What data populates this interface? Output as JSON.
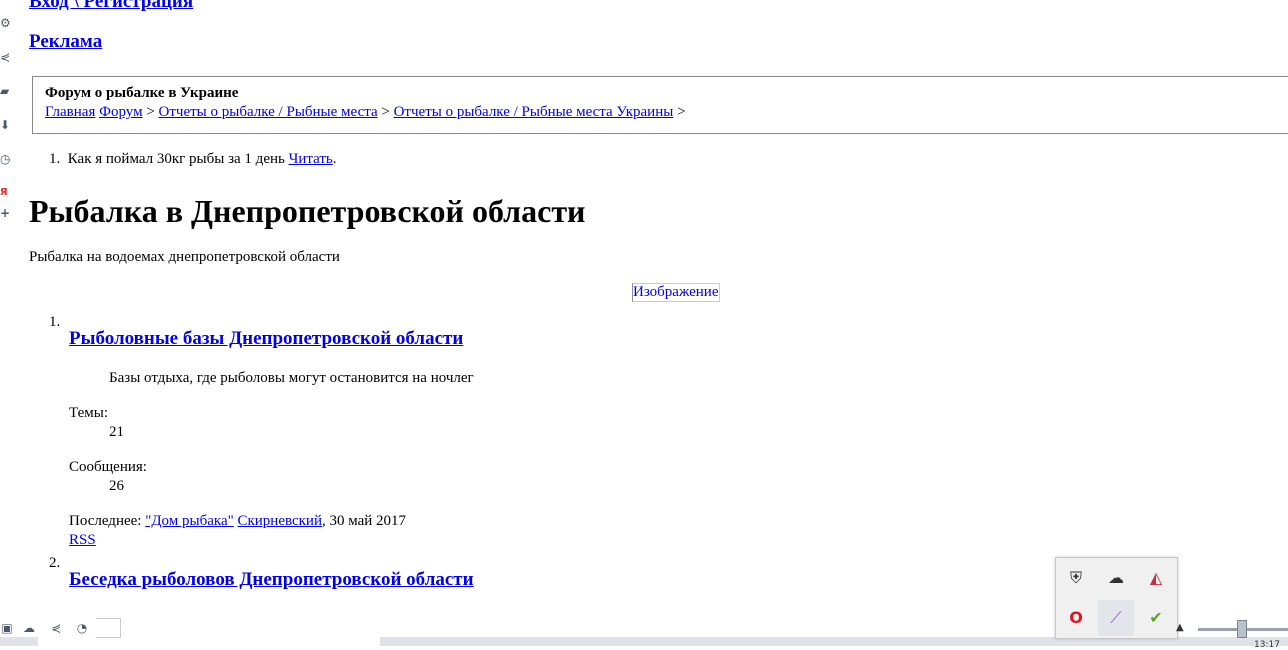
{
  "header": {
    "login_link": "Вход \\ Регистрация",
    "ads_link": "Реклама"
  },
  "breadcrumb": {
    "site_title": "Форум о рыбалке в Украине",
    "items": [
      "Главная",
      "Форум",
      "Отчеты о рыбалке / Рыбные места",
      "Отчеты о рыбалке / Рыбные места Украины"
    ],
    "separator": ">"
  },
  "news": {
    "number": "1.",
    "text": "Как я поймал 30кг рыбы за 1 день",
    "link": "Читать",
    "tail": "."
  },
  "page": {
    "title": "Рыбалка в Днепропетровской области",
    "description": "Рыбалка на водоемах днепропетровской области",
    "image_alt": "Изображение"
  },
  "forums": [
    {
      "number": "1.",
      "title": "Рыболовные базы Днепропетровской области",
      "description": "Базы отдыха, где рыболовы могут остановится на ночлег",
      "topics_label": "Темы:",
      "topics": "21",
      "messages_label": "Сообщения:",
      "messages": "26",
      "last_label": "Последнее:",
      "last_thread": "\"Дом рыбака\"",
      "last_user": "Скирневский",
      "last_date": ", 30 май 2017",
      "rss": "RSS"
    },
    {
      "number": "2.",
      "title": "Беседка рыболовов Днепропетровской области"
    }
  ],
  "left_icons": [
    "gear-icon",
    "share-icon",
    "note-icon",
    "download-icon",
    "clock-icon",
    "yandex-icon",
    "plus-icon"
  ],
  "taskbar": {
    "icons": [
      "window-icon",
      "cloud-icon",
      "share-icon",
      "speed-icon"
    ],
    "clock": "13:17"
  },
  "tray": {
    "icons": [
      "security-shield-icon",
      "cloud-off-icon",
      "antivirus-icon",
      "opera-icon",
      "feather-icon",
      "check-shield-icon"
    ],
    "colors": {
      "opera": "#e0141e",
      "feather": "#8a5cd6",
      "check": "#5aa82a",
      "mcafee": "#c8313c"
    }
  }
}
